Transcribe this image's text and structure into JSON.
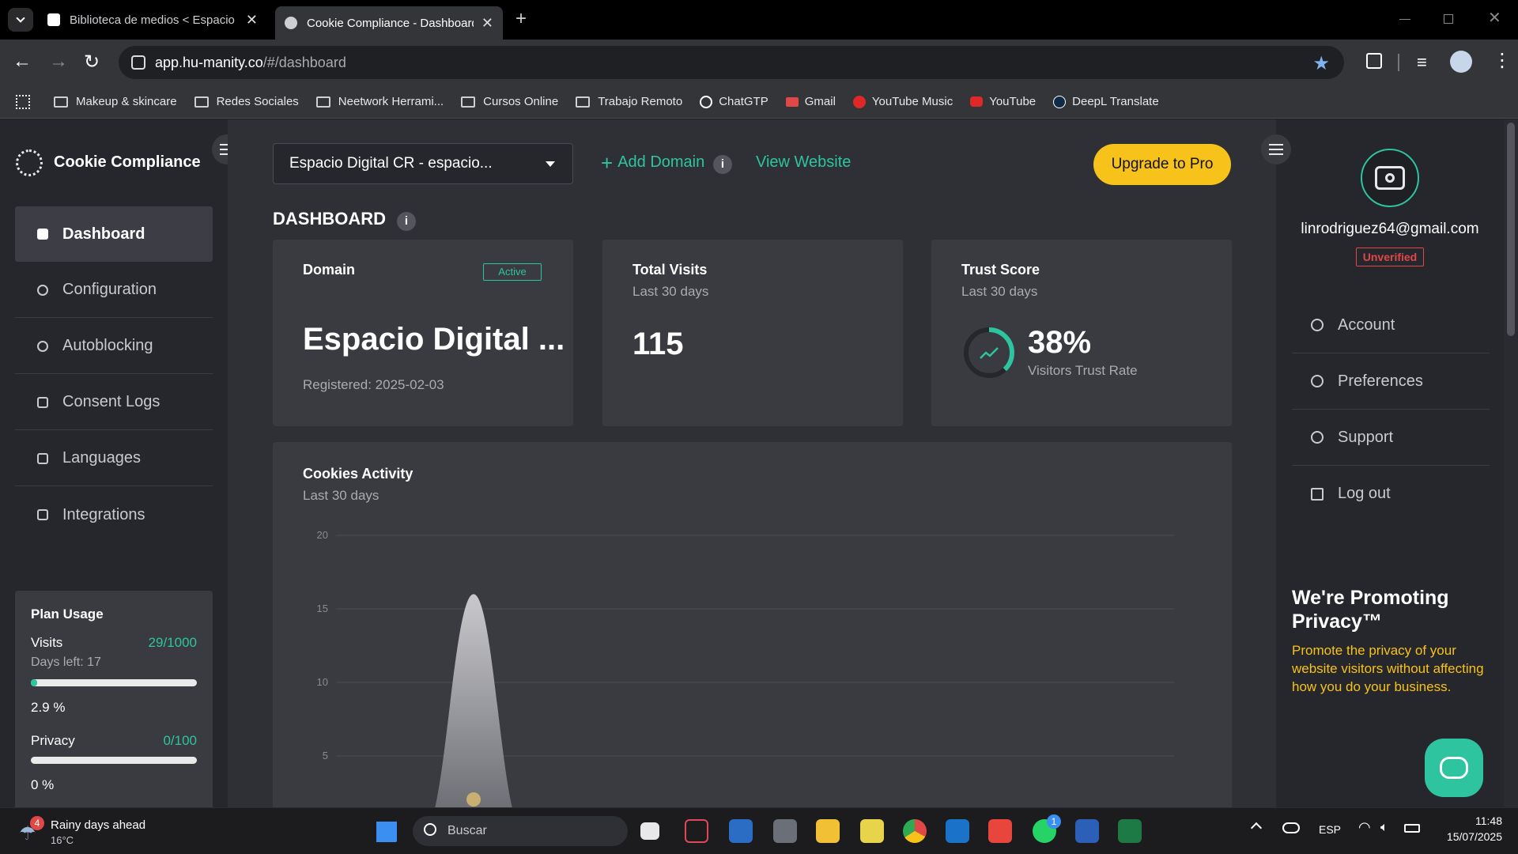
{
  "browser": {
    "tabs": [
      {
        "title": "Biblioteca de medios < Espacio",
        "active": false
      },
      {
        "title": "Cookie Compliance - Dashboard",
        "active": true
      }
    ],
    "url_host": "app.hu-manity.co",
    "url_path": "/#/dashboard",
    "bookmarks": [
      {
        "label": "Makeup & skincare",
        "icon": "folder-icon"
      },
      {
        "label": "Redes Sociales",
        "icon": "folder-icon"
      },
      {
        "label": "Neetwork Herrami...",
        "icon": "folder-icon"
      },
      {
        "label": "Cursos Online",
        "icon": "folder-icon"
      },
      {
        "label": "Trabajo Remoto",
        "icon": "folder-icon"
      },
      {
        "label": "ChatGTP",
        "icon": "chatgpt-icon"
      },
      {
        "label": "Gmail",
        "icon": "gmail-icon"
      },
      {
        "label": "YouTube Music",
        "icon": "youtube-music-icon"
      },
      {
        "label": "YouTube",
        "icon": "youtube-icon"
      },
      {
        "label": "DeepL Translate",
        "icon": "deepl-icon"
      }
    ]
  },
  "sidebar": {
    "brand": "Cookie Compliance",
    "items": [
      {
        "label": "Dashboard",
        "active": true
      },
      {
        "label": "Configuration",
        "active": false
      },
      {
        "label": "Autoblocking",
        "active": false
      },
      {
        "label": "Consent Logs",
        "active": false
      },
      {
        "label": "Languages",
        "active": false
      },
      {
        "label": "Integrations",
        "active": false
      }
    ],
    "plan": {
      "title": "Plan Usage",
      "visits_label": "Visits",
      "visits_value": "29/1000",
      "days_left": "Days left: 17",
      "visits_percent": "2.9 %",
      "visits_fraction": 0.029,
      "privacy_label": "Privacy",
      "privacy_value": "0/100",
      "privacy_percent": "0 %",
      "privacy_fraction": 0
    }
  },
  "header": {
    "domain_select": "Espacio Digital CR - espacio...",
    "add_domain": "Add Domain",
    "view_website": "View Website",
    "upgrade": "Upgrade to Pro"
  },
  "dashboard": {
    "title": "DASHBOARD",
    "domain_card": {
      "label": "Domain",
      "status": "Active",
      "name": "Espacio Digital ...",
      "registered": "Registered: 2025-02-03"
    },
    "visits_card": {
      "label": "Total Visits",
      "period": "Last 30 days",
      "value": "115"
    },
    "trust_card": {
      "label": "Trust Score",
      "period": "Last 30 days",
      "value": "38%",
      "caption": "Visitors Trust Rate",
      "fraction": 0.38
    },
    "activity": {
      "title": "Cookies Activity",
      "period": "Last 30 days"
    }
  },
  "chart_data": {
    "type": "area",
    "title": "Cookies Activity",
    "ylim": [
      0,
      20
    ],
    "yticks": [
      "20",
      "15",
      "10",
      "5"
    ],
    "grid": true,
    "series": [
      {
        "values": [
          0,
          0,
          16,
          0,
          0,
          0,
          0,
          0,
          0,
          0,
          0,
          0,
          0,
          0,
          0,
          0,
          0,
          0,
          0,
          0,
          0,
          0,
          0,
          0,
          0,
          0,
          0,
          0,
          0,
          0
        ]
      }
    ]
  },
  "rightpanel": {
    "email": "linrodriguez64@gmail.com",
    "badge": "Unverified",
    "items": [
      {
        "label": "Account",
        "icon": "user-icon"
      },
      {
        "label": "Preferences",
        "icon": "user-settings-icon"
      },
      {
        "label": "Support",
        "icon": "lifebuoy-icon"
      },
      {
        "label": "Log out",
        "icon": "logout-icon"
      }
    ],
    "promo_title": "We're Promoting Privacy™",
    "promo_text": "Promote the privacy of your website visitors without affecting how you do your business."
  },
  "taskbar": {
    "weather_title": "Rainy days ahead",
    "weather_temp": "16°C",
    "weather_badge": "4",
    "search": "Buscar",
    "lang": "ESP",
    "time": "11:48",
    "date": "15/07/2025",
    "whatsapp_badge": "1"
  },
  "colors": {
    "accent": "#2ec4a0",
    "upgrade": "#f7c21a",
    "promo_text": "#f7c21a",
    "unverified": "#e04848"
  }
}
